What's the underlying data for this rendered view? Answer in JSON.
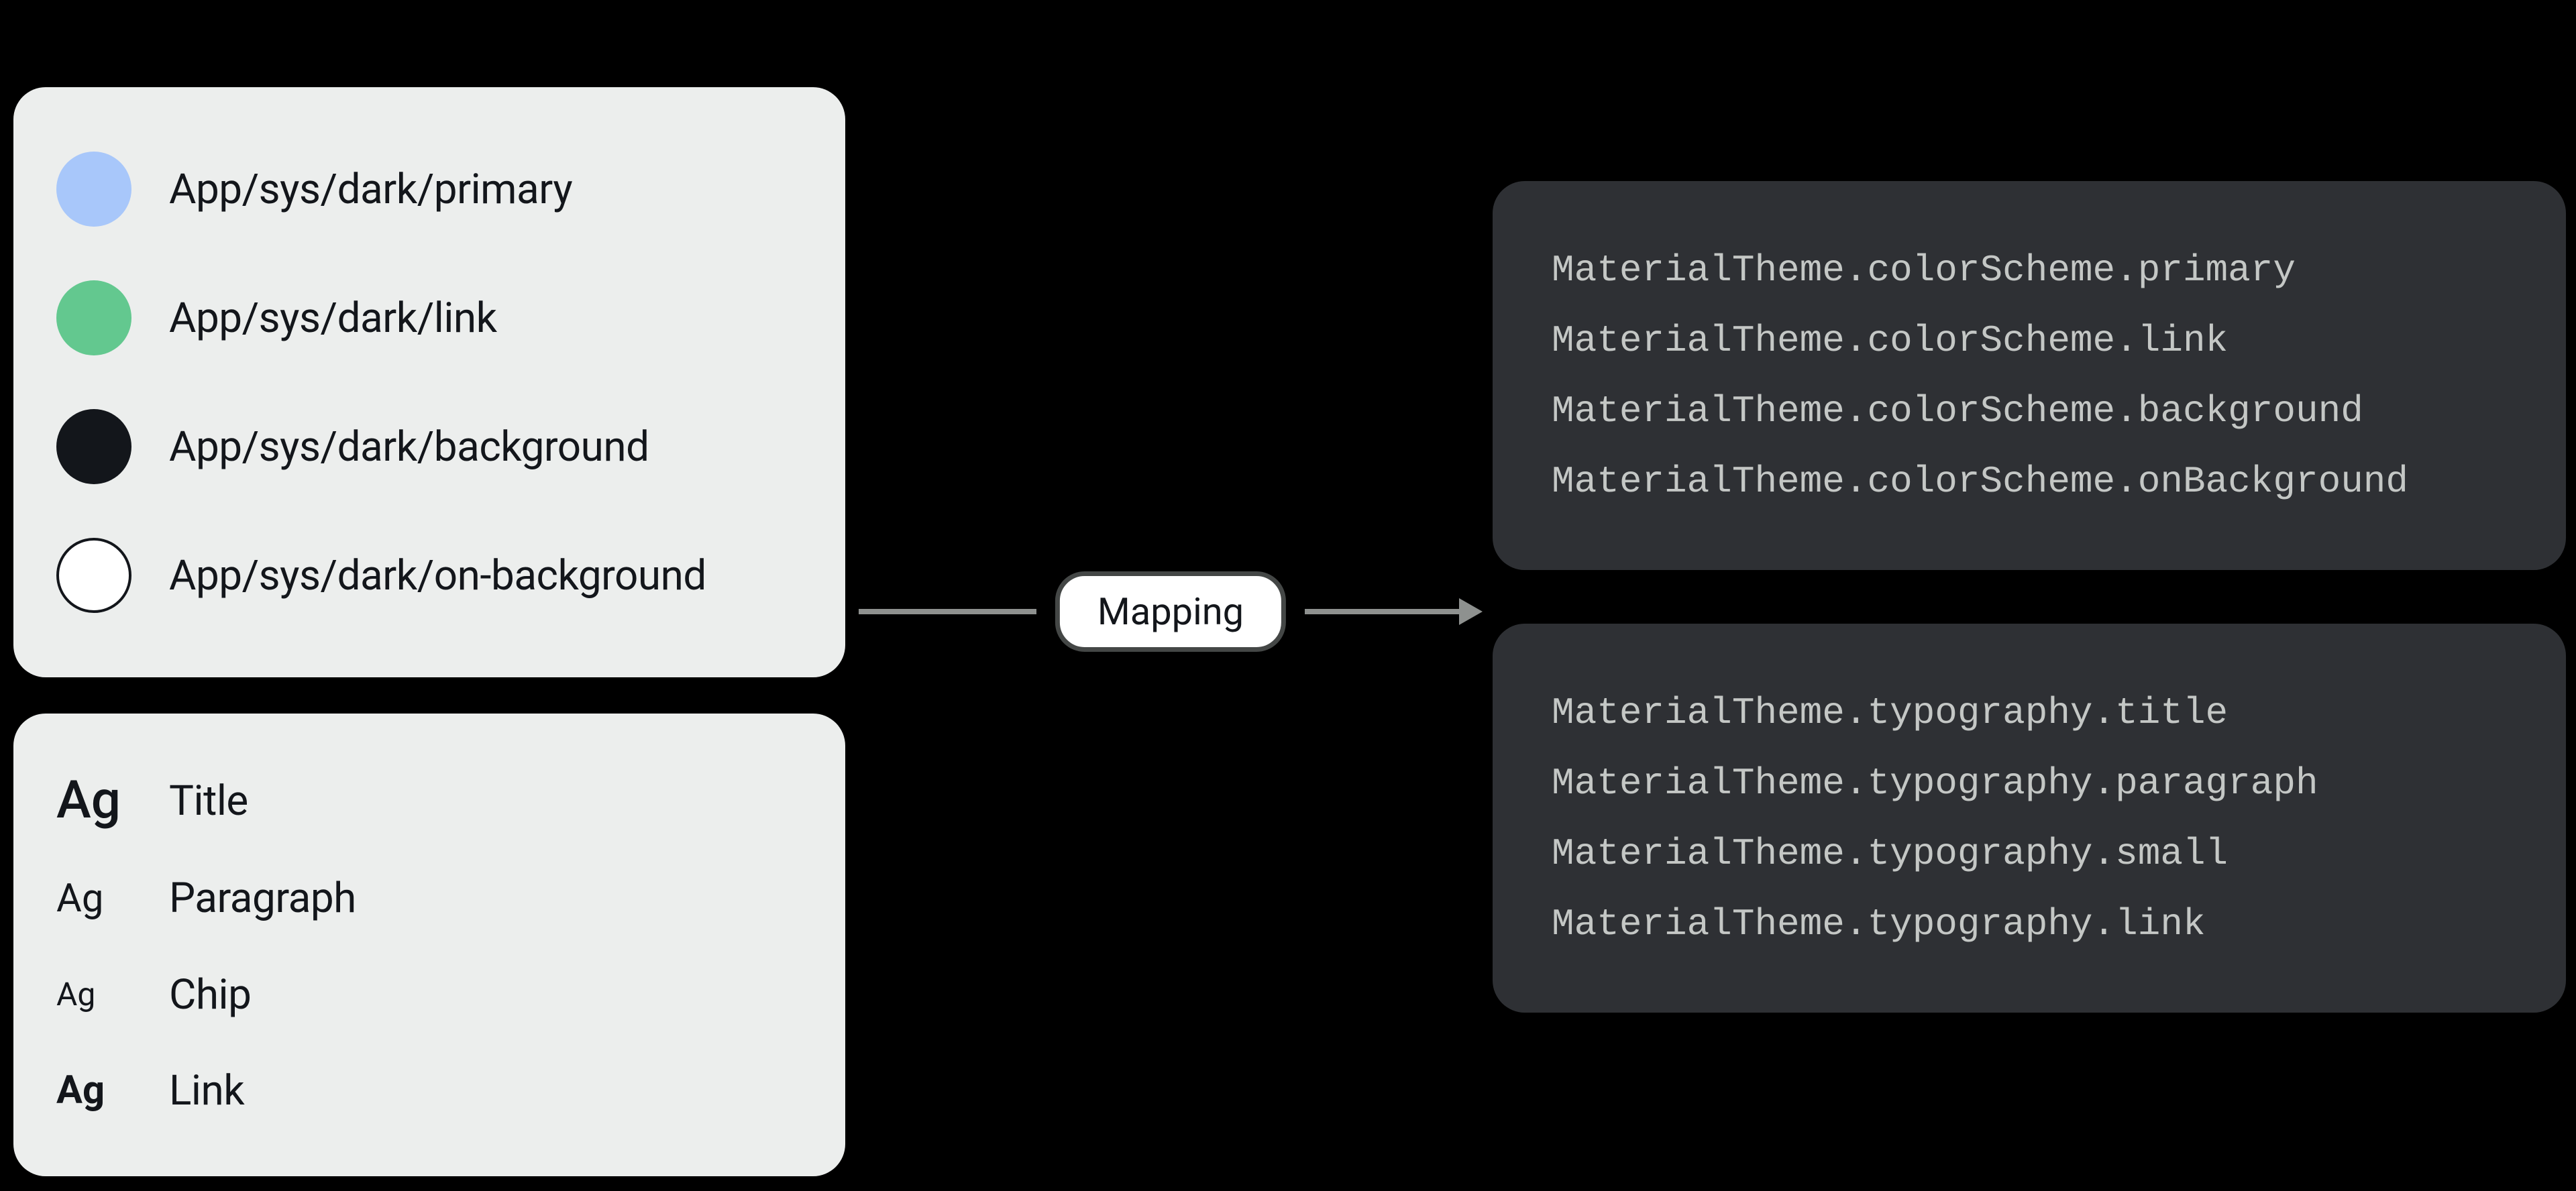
{
  "colors": {
    "items": [
      {
        "label": "App/sys/dark/primary",
        "hex": "#a8c7fa",
        "stroke": false
      },
      {
        "label": "App/sys/dark/link",
        "hex": "#63c88f",
        "stroke": false
      },
      {
        "label": "App/sys/dark/background",
        "hex": "#13161b",
        "stroke": false
      },
      {
        "label": "App/sys/dark/on-background",
        "hex": "#ffffff",
        "stroke": true
      }
    ]
  },
  "typography": {
    "sample": "Ag",
    "items": [
      {
        "label": "Title",
        "style": "ag-title"
      },
      {
        "label": "Paragraph",
        "style": "ag-para"
      },
      {
        "label": "Chip",
        "style": "ag-chip"
      },
      {
        "label": "Link",
        "style": "ag-link"
      }
    ]
  },
  "mapping_label": "Mapping",
  "code": {
    "color_lines": [
      "MaterialTheme.colorScheme.primary",
      "MaterialTheme.colorScheme.link",
      "MaterialTheme.colorScheme.background",
      "MaterialTheme.colorScheme.onBackground"
    ],
    "type_lines": [
      "MaterialTheme.typography.title",
      "MaterialTheme.typography.paragraph",
      "MaterialTheme.typography.small",
      "MaterialTheme.typography.link"
    ]
  }
}
